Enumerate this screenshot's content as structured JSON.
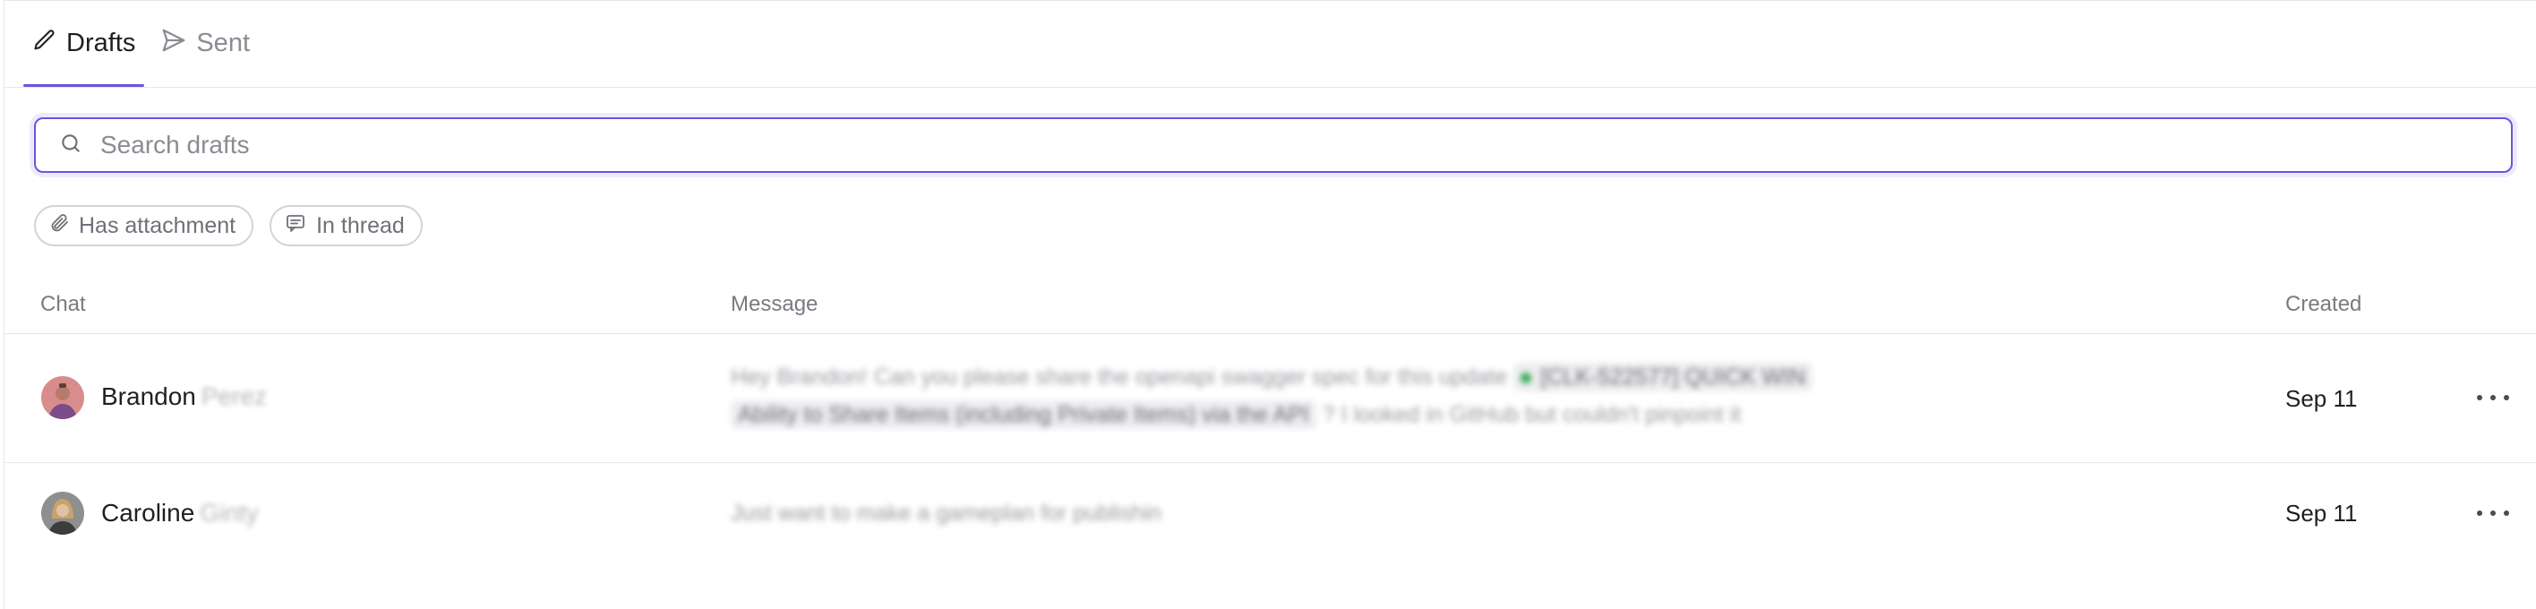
{
  "tabs": [
    {
      "label": "Drafts",
      "icon": "pencil-icon",
      "active": true
    },
    {
      "label": "Sent",
      "icon": "send-icon",
      "active": false
    }
  ],
  "search": {
    "placeholder": "Search drafts",
    "value": ""
  },
  "filters": [
    {
      "label": "Has attachment",
      "icon": "paperclip-icon"
    },
    {
      "label": "In thread",
      "icon": "message-icon"
    }
  ],
  "table": {
    "columns": {
      "chat": "Chat",
      "message": "Message",
      "created": "Created"
    },
    "rows": [
      {
        "first_name": "Brandon",
        "last_name": "Perez",
        "message_line1": "Hey Brandon! Can you please share the openapi swagger spec for this update",
        "message_tag": "[CLK-522577] QUICK WIN",
        "message_link": "Ability to Share Items (including Private Items) via the API",
        "message_line2_tail": "? I looked in GitHub but couldn't pinpoint it",
        "created": "Sep 11"
      },
      {
        "first_name": "Caroline",
        "last_name": "Ginty",
        "message_line1": "Just want to make a gameplan for publishin",
        "created": "Sep 11"
      }
    ]
  },
  "colors": {
    "accent": "#6a55e0",
    "focus_ring": "#eeebfd",
    "border": "#e7e7ea"
  }
}
